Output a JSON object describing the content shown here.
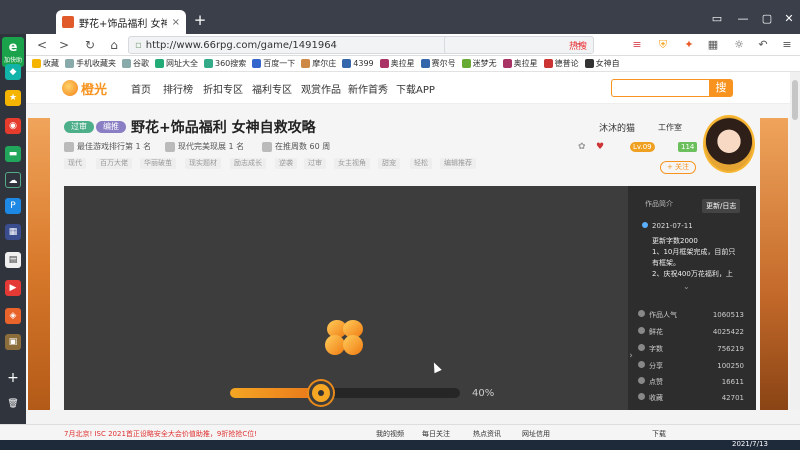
{
  "browser": {
    "tab_title": "野花+饰品福利 女神自救攻略",
    "tab_close": "×",
    "new_tab": "+",
    "address": "http://www.66rpg.com/game/1491964",
    "search_hot": "热搜",
    "back": "<",
    "forward": ">",
    "refresh": "↻",
    "home": "⌂",
    "window_controls": [
      "▭",
      "—",
      "▢",
      "✕"
    ]
  },
  "bookmarks": [
    {
      "label": "收藏"
    },
    {
      "label": "手机收藏夹"
    },
    {
      "label": "谷歌"
    },
    {
      "label": "网址大全"
    },
    {
      "label": "360搜索"
    },
    {
      "label": "百度一下"
    },
    {
      "label": "摩尔庄"
    },
    {
      "label": "4399"
    },
    {
      "label": "奥拉星"
    },
    {
      "label": "赛尔号"
    },
    {
      "label": "迷梦无"
    },
    {
      "label": "奥拉星"
    },
    {
      "label": "德普论"
    },
    {
      "label": "女神自"
    }
  ],
  "site": {
    "logo": "橙光",
    "nav": [
      "首页",
      "排行榜",
      "折扣专区",
      "福利专区",
      "观赏作品",
      "新作首秀",
      "下载APP"
    ],
    "search_button": "搜"
  },
  "game": {
    "tags": [
      {
        "label": "过审",
        "color": "#4caf8a"
      },
      {
        "label": "编推",
        "color": "#8a7fc4"
      }
    ],
    "title": "野花+饰品福利 女神自救攻略",
    "meta": [
      "最佳游戏排行第 1 名",
      "现代完美现展 1 名",
      "在推周数 60 周"
    ],
    "chips": [
      "现代",
      "百万大佬",
      "华丽破茧",
      "现实题材",
      "励志成长",
      "逆袭",
      "过审",
      "女主视角",
      "甜宠",
      "轻松",
      "编辑推荐"
    ],
    "author": "沐沐的猫",
    "work_label": "工作室",
    "level": "Lv.09",
    "count": "114",
    "follow": "+ 关注"
  },
  "player": {
    "progress_percent": 40,
    "progress_label": "40%"
  },
  "info_panel": {
    "tabs": [
      "作品简介",
      "更新/日志"
    ],
    "active_tab": "更新/日志",
    "date": "2021-07-11",
    "lines": [
      "更新字数2000",
      "1、10月框架完成，目前只",
      "有框架。",
      "2、庆祝400万花福利，上"
    ],
    "stats": [
      {
        "label": "作品人气",
        "value": "1060513"
      },
      {
        "label": "鲜花",
        "value": "4025422"
      },
      {
        "label": "字数",
        "value": "756219"
      },
      {
        "label": "分享",
        "value": "100250"
      },
      {
        "label": "点赞",
        "value": "16611"
      },
      {
        "label": "收藏",
        "value": "42701"
      }
    ],
    "collapse": "›"
  },
  "statusbar": {
    "news": "7月北京! ISC 2021首正设略安全大会价值助推，9折抢抢C位!",
    "items": [
      "我的视频",
      "每日关注",
      "热点资讯",
      "网址信用"
    ],
    "download": "下载"
  },
  "taskbar": {
    "date": "2021/7/13"
  },
  "sidebar": {
    "badge_letter": "e",
    "badge_text": "加快助手"
  }
}
